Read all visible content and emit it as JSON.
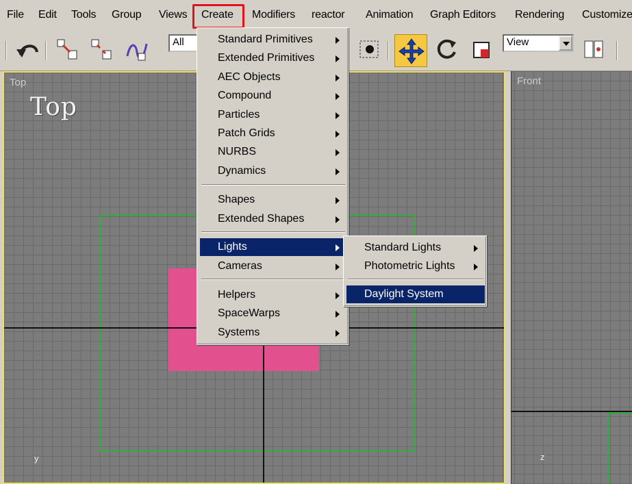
{
  "menubar": {
    "items": [
      "File",
      "Edit",
      "Tools",
      "Group",
      "Views",
      "Create",
      "Modifiers",
      "reactor",
      "Animation",
      "Graph Editors",
      "Rendering",
      "Customize"
    ]
  },
  "toolbar": {
    "selection_filter": "All",
    "reference_coord": "View"
  },
  "viewports": {
    "top": {
      "label": "Top",
      "big_label": "Top",
      "axis": "y"
    },
    "front": {
      "label": "Front",
      "axis": "z"
    }
  },
  "create_menu": {
    "items": [
      {
        "label": "Standard Primitives",
        "submenu": true
      },
      {
        "label": "Extended Primitives",
        "submenu": true
      },
      {
        "label": "AEC Objects",
        "submenu": true
      },
      {
        "label": "Compound",
        "submenu": true
      },
      {
        "label": "Particles",
        "submenu": true
      },
      {
        "label": "Patch Grids",
        "submenu": true
      },
      {
        "label": "NURBS",
        "submenu": true
      },
      {
        "label": "Dynamics",
        "submenu": true
      },
      {
        "label": "Shapes",
        "submenu": true
      },
      {
        "label": "Extended Shapes",
        "submenu": true
      },
      {
        "label": "Lights",
        "submenu": true,
        "active": true
      },
      {
        "label": "Cameras",
        "submenu": true
      },
      {
        "label": "Helpers",
        "submenu": true
      },
      {
        "label": "SpaceWarps",
        "submenu": true
      },
      {
        "label": "Systems",
        "submenu": true
      }
    ]
  },
  "lights_submenu": {
    "items": [
      {
        "label": "Standard Lights",
        "submenu": true
      },
      {
        "label": "Photometric Lights",
        "submenu": true
      },
      {
        "label": "Daylight System",
        "submenu": false,
        "active": true
      }
    ]
  },
  "colors": {
    "highlight_box": "#e0141c",
    "menu_selection": "#0a246a",
    "active_viewport_border": "#f0e060",
    "object_pink": "#e2508e",
    "grid_green": "#2fae3a"
  }
}
